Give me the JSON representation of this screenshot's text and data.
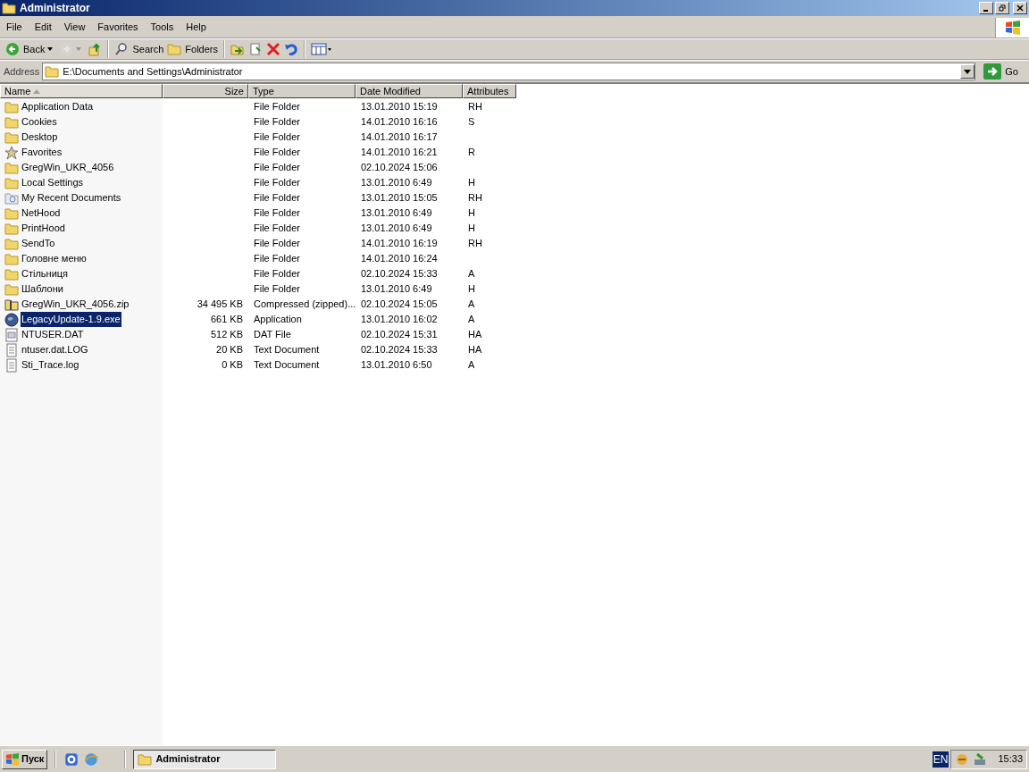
{
  "window": {
    "title": "Administrator"
  },
  "menu": [
    "File",
    "Edit",
    "View",
    "Favorites",
    "Tools",
    "Help"
  ],
  "toolbar": [
    {
      "kind": "back",
      "label": "Back",
      "disabled": false
    },
    {
      "kind": "forward",
      "disabled": true
    },
    {
      "kind": "up",
      "disabled": false
    },
    {
      "kind": "search",
      "label": "Search",
      "disabled": false
    },
    {
      "kind": "folders",
      "label": "Folders",
      "disabled": false
    },
    {
      "kind": "move",
      "disabled": false
    },
    {
      "kind": "copy",
      "disabled": false
    },
    {
      "kind": "delete",
      "disabled": false
    },
    {
      "kind": "undo",
      "disabled": false
    },
    {
      "kind": "views",
      "disabled": false
    }
  ],
  "address": {
    "label": "Address",
    "value": "E:\\Documents and Settings\\Administrator",
    "go": "Go"
  },
  "columns": [
    {
      "label": "Name",
      "sorted": true
    },
    {
      "label": "Size",
      "sorted": false
    },
    {
      "label": "Type",
      "sorted": false
    },
    {
      "label": "Date Modified",
      "sorted": false
    },
    {
      "label": "Attributes",
      "sorted": false
    }
  ],
  "rows": [
    {
      "kind": "folder",
      "name": "Application Data",
      "size": "",
      "type": "File Folder",
      "date": "13.01.2010 15:19",
      "attributes": "RH",
      "selected": false
    },
    {
      "kind": "folder",
      "name": "Cookies",
      "size": "",
      "type": "File Folder",
      "date": "14.01.2010 16:16",
      "attributes": "S",
      "selected": false
    },
    {
      "kind": "folder",
      "name": "Desktop",
      "size": "",
      "type": "File Folder",
      "date": "14.01.2010 16:17",
      "attributes": "",
      "selected": false
    },
    {
      "kind": "favorites",
      "name": "Favorites",
      "size": "",
      "type": "File Folder",
      "date": "14.01.2010 16:21",
      "attributes": "R",
      "selected": false
    },
    {
      "kind": "folder",
      "name": "GregWin_UKR_4056",
      "size": "",
      "type": "File Folder",
      "date": "02.10.2024 15:06",
      "attributes": "",
      "selected": false
    },
    {
      "kind": "folder",
      "name": "Local Settings",
      "size": "",
      "type": "File Folder",
      "date": "13.01.2010 6:49",
      "attributes": "H",
      "selected": false
    },
    {
      "kind": "recent",
      "name": "My Recent Documents",
      "size": "",
      "type": "File Folder",
      "date": "13.01.2010 15:05",
      "attributes": "RH",
      "selected": false
    },
    {
      "kind": "folder",
      "name": "NetHood",
      "size": "",
      "type": "File Folder",
      "date": "13.01.2010 6:49",
      "attributes": "H",
      "selected": false
    },
    {
      "kind": "folder",
      "name": "PrintHood",
      "size": "",
      "type": "File Folder",
      "date": "13.01.2010 6:49",
      "attributes": "H",
      "selected": false
    },
    {
      "kind": "folder",
      "name": "SendTo",
      "size": "",
      "type": "File Folder",
      "date": "14.01.2010 16:19",
      "attributes": "RH",
      "selected": false
    },
    {
      "kind": "folder",
      "name": "Головне меню",
      "size": "",
      "type": "File Folder",
      "date": "14.01.2010 16:24",
      "attributes": "",
      "selected": false
    },
    {
      "kind": "folder",
      "name": "Стільниця",
      "size": "",
      "type": "File Folder",
      "date": "02.10.2024 15:33",
      "attributes": "A",
      "selected": false
    },
    {
      "kind": "folder",
      "name": "Шаблони",
      "size": "",
      "type": "File Folder",
      "date": "13.01.2010 6:49",
      "attributes": "H",
      "selected": false
    },
    {
      "kind": "zip",
      "name": "GregWin_UKR_4056.zip",
      "size": "34 495 KB",
      "type": "Compressed (zipped)...",
      "date": "02.10.2024 15:05",
      "attributes": "A",
      "selected": false
    },
    {
      "kind": "exe",
      "name": "LegacyUpdate-1.9.exe",
      "size": "661 KB",
      "type": "Application",
      "date": "13.01.2010 16:02",
      "attributes": "A",
      "selected": true
    },
    {
      "kind": "dat",
      "name": "NTUSER.DAT",
      "size": "512 KB",
      "type": "DAT File",
      "date": "02.10.2024 15:31",
      "attributes": "HA",
      "selected": false
    },
    {
      "kind": "text",
      "name": "ntuser.dat.LOG",
      "size": "20 KB",
      "type": "Text Document",
      "date": "02.10.2024 15:33",
      "attributes": "HA",
      "selected": false
    },
    {
      "kind": "text",
      "name": "Sti_Trace.log",
      "size": "0 KB",
      "type": "Text Document",
      "date": "13.01.2010 6:50",
      "attributes": "A",
      "selected": false
    }
  ],
  "taskbar": {
    "start": "Пуск",
    "quick_launch": [
      {
        "kind": "update"
      },
      {
        "kind": "browser"
      }
    ],
    "tasks": [
      {
        "label": "Administrator",
        "selected": true
      }
    ],
    "language": "EN",
    "clock": "15:33"
  }
}
